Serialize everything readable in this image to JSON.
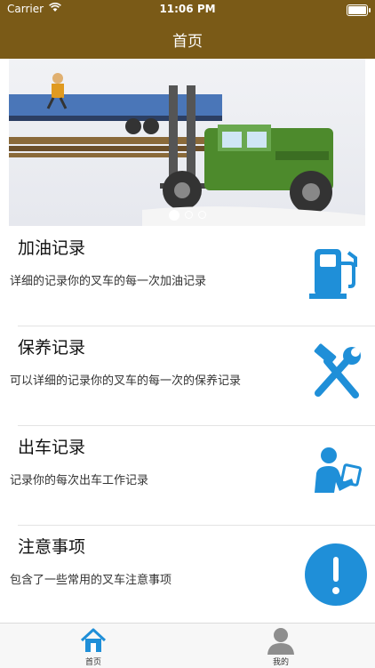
{
  "status_bar": {
    "carrier": "Carrier",
    "time": "11:06 PM"
  },
  "nav": {
    "title": "首页"
  },
  "banner": {
    "page_count": 3,
    "active_page": 1
  },
  "rows": [
    {
      "title": "加油记录",
      "desc": "详细的记录你的叉车的每一次加油记录",
      "icon": "fuel-pump-icon"
    },
    {
      "title": "保养记录",
      "desc": "可以详细的记录你的叉车的每一次的保养记录",
      "icon": "wrench-hammer-icon"
    },
    {
      "title": "出车记录",
      "desc": "记录你的每次出车工作记录",
      "icon": "person-clipboard-icon"
    },
    {
      "title": "注意事项",
      "desc": "包含了一些常用的叉车注意事项",
      "icon": "exclamation-circle-icon"
    }
  ],
  "tabs": [
    {
      "label": "首页",
      "icon": "home-icon",
      "selected": true
    },
    {
      "label": "我的",
      "icon": "person-icon",
      "selected": false
    }
  ],
  "colors": {
    "nav_brown": "#7a5a17",
    "icon_blue": "#1f8fd8",
    "forklift_green": "#4d8a2c"
  }
}
